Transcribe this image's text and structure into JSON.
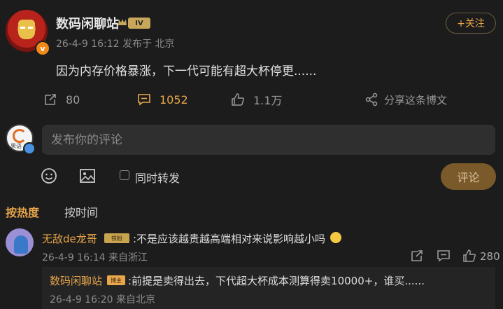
{
  "post": {
    "author_name": "数码闲聊站",
    "level_badge": "IV",
    "verified_badge": "v",
    "meta": "26-4-9 16:12  发布于 北京",
    "follow_label": "+关注",
    "text": "因为内存价格暴涨，下一代可能有超大杯停更......",
    "reposts": "80",
    "comments": "1052",
    "likes": "1.1万",
    "share_label": "分享这条博文"
  },
  "composer": {
    "avatar_text": "果语",
    "placeholder": "发布你的评论",
    "repost_label": "同时转发",
    "submit_label": "评论"
  },
  "sort_tabs": {
    "hot": "按热度",
    "time": "按时间"
  },
  "comments": [
    {
      "name": "无敌de龙哥",
      "badge": "铁粉",
      "text": ":不是应该越贵越高端相对来说影响越小吗",
      "meta": "26-4-9 16:14  来自浙江",
      "likes": "280",
      "reply": {
        "name": "数码闲聊站",
        "badge": "博主",
        "text": ":前提是卖得出去，下代超大杯成本测算得卖10000+，谁买......",
        "meta": "26-4-9 16:20  来自北京"
      }
    }
  ],
  "colors": {
    "accent": "#e8a64a",
    "background": "#1c1c1c"
  },
  "icons": [
    "repost-icon",
    "comment-icon",
    "like-icon",
    "share-icon",
    "emoji-icon",
    "image-icon"
  ]
}
